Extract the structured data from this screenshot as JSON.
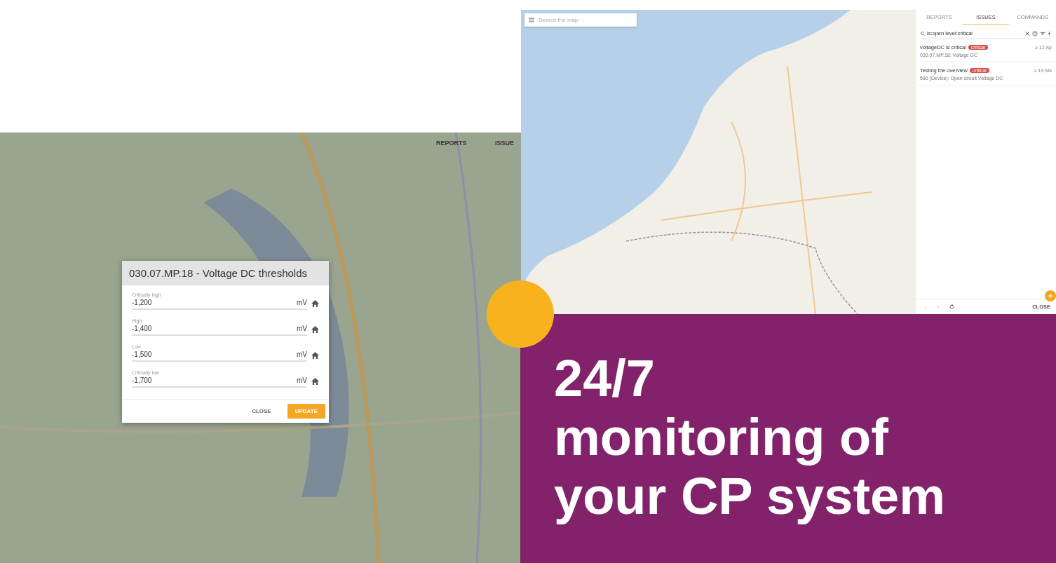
{
  "left_screenshot": {
    "tab_labels": [
      "REPORTS",
      "ISSUE"
    ],
    "dialog": {
      "title": "030.07.MP.18 - Voltage DC thresholds",
      "fields": [
        {
          "label": "Critically high",
          "value": "-1,200",
          "unit": "mV"
        },
        {
          "label": "High",
          "value": "-1,400",
          "unit": "mV"
        },
        {
          "label": "Low",
          "value": "-1,500",
          "unit": "mV"
        },
        {
          "label": "Critically low",
          "value": "-1,700",
          "unit": "mV"
        }
      ],
      "buttons": [
        {
          "label": "CLOSE",
          "kind": "text"
        },
        {
          "label": "UPDATE",
          "kind": "primary"
        }
      ]
    }
  },
  "right_screenshot": {
    "search": {
      "placeholder": "Search the map"
    },
    "tabs": [
      {
        "label": "REPORTS",
        "selected": false
      },
      {
        "label": "ISSUES",
        "selected": true
      },
      {
        "label": "COMMANDS",
        "selected": false
      }
    ],
    "filter": {
      "value": "is:open level:critical"
    },
    "issues": [
      {
        "title": "voltageDC is critical",
        "badge": "critical",
        "subtitle": "030.07.MP.18: Voltage DC",
        "time": "≥ 12 Ap"
      },
      {
        "title": "Testing the overview",
        "badge": "critical",
        "subtitle": "580 (Device): Open circuit Voltage DC",
        "time": "≥ 19 Ma"
      }
    ],
    "footer": {
      "close": "CLOSE"
    }
  },
  "headline": [
    "24/7",
    "monitoring of",
    "your CP system"
  ]
}
